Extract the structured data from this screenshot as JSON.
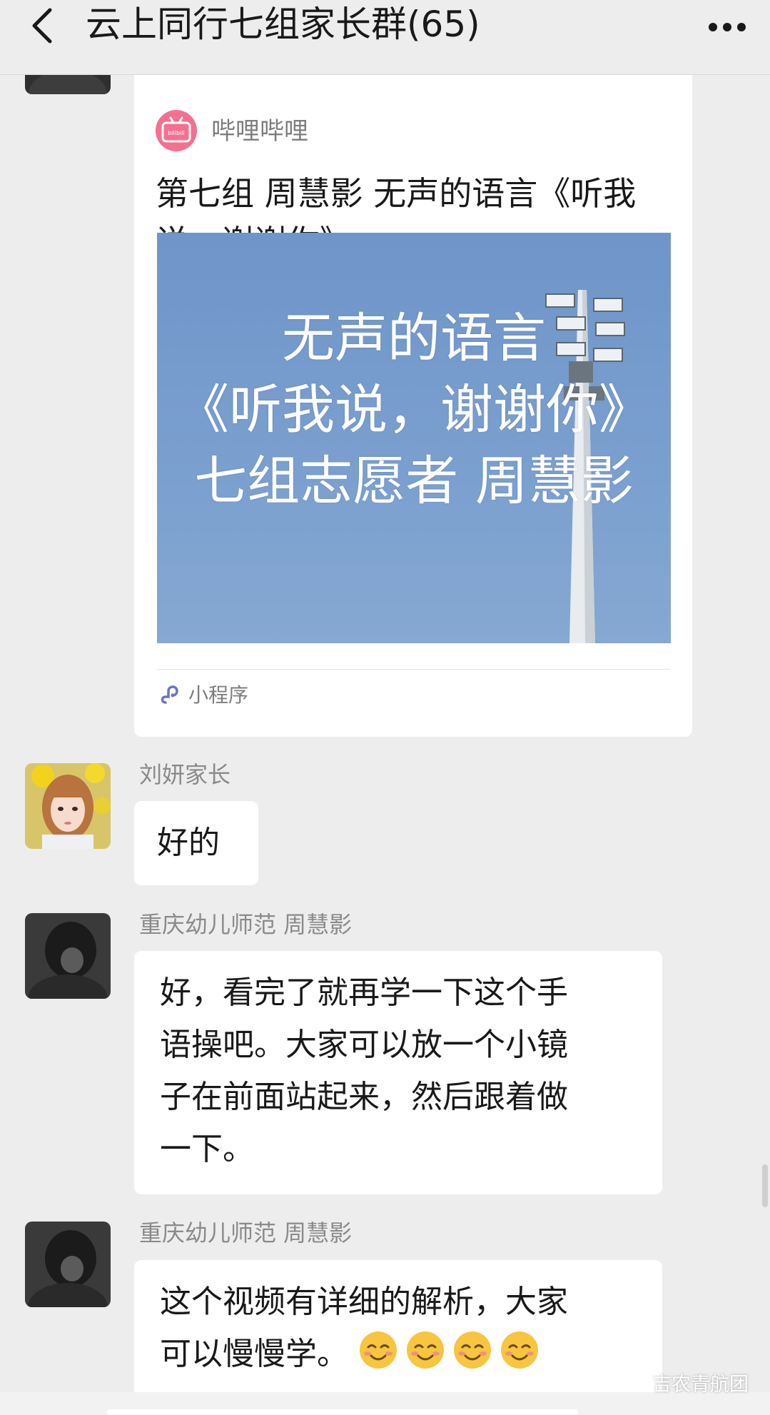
{
  "header": {
    "title": "云上同行七组家长群(65)"
  },
  "card": {
    "app_name": "哔哩哔哩",
    "title": "第七组 周慧影  无声的语言《听我说，谢谢你》",
    "thumbnail_lines": [
      "无声的语言",
      "《听我说，谢谢你》",
      "七组志愿者 周慧影"
    ],
    "footer_label": "小程序",
    "app_icon_text": "bilibili"
  },
  "messages": [
    {
      "sender": "刘妍家长",
      "lines": [
        "好的"
      ]
    },
    {
      "sender": "重庆幼儿师范  周慧影",
      "lines": [
        "好，看完了就再学一下这个手",
        "语操吧。大家可以放一个小镜",
        "子在前面站起来，然后跟着做",
        "一下。"
      ]
    },
    {
      "sender": "重庆幼儿师范  周慧影",
      "lines": [
        "这个视频有详细的解析，大家",
        "可以慢慢学。"
      ],
      "emoji_count": 4
    }
  ],
  "watermark": {
    "text": "吉农青航团"
  },
  "colors": {
    "chat_background": "#ededed",
    "bubble": "#ffffff",
    "sender_name": "#8a8a8a",
    "bilibili_pink": "#f5708f",
    "thumbnail_sky": "#7ba0cf"
  }
}
